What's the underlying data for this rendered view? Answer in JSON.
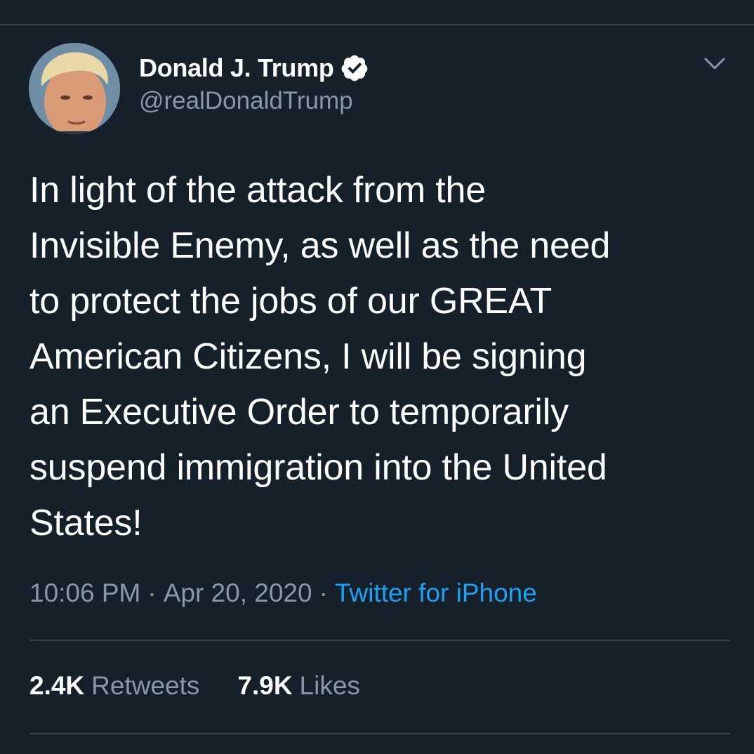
{
  "author": {
    "display_name": "Donald J. Trump",
    "handle": "@realDonaldTrump",
    "verified_icon": "verified-badge-icon",
    "avatar": "profile-photo"
  },
  "tweet": {
    "text": "In light of the attack from the\nInvisible Enemy, as well as the need\nto protect the jobs of our GREAT\nAmerican Citizens, I will be signing\nan Executive Order to temporarily\nsuspend immigration into the United\nStates!",
    "time": "10:06 PM",
    "date": "Apr 20, 2020",
    "separator": "·",
    "source": "Twitter for iPhone"
  },
  "stats": {
    "retweets_count": "2.4K",
    "retweets_label": "Retweets",
    "likes_count": "7.9K",
    "likes_label": "Likes"
  },
  "icons": {
    "menu": "chevron-down-icon"
  },
  "colors": {
    "background": "#15202b",
    "text_primary": "#ffffff",
    "text_secondary": "#8899a6",
    "link": "#1da1f2",
    "divider": "#38444d"
  }
}
